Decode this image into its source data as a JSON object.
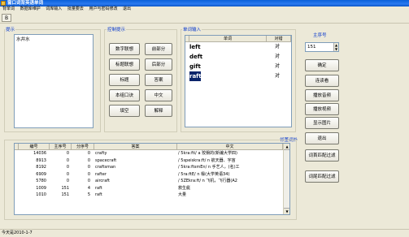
{
  "window": {
    "title": "窗口词背英语单词"
  },
  "menu": [
    "背单词",
    "数据库维护",
    "词库输入",
    "批量要去",
    "用户与密码修改",
    "退出"
  ],
  "toolbar": {
    "button_label": "B"
  },
  "hint": {
    "label": "提示",
    "list_item": "水井水"
  },
  "controls": {
    "label": "控制提示",
    "buttons": [
      "数字联想",
      "前部分",
      "标题联想",
      "后部分",
      "标题",
      "答案",
      "本组口诀",
      "中文",
      "填空",
      "解释"
    ]
  },
  "word_input": {
    "label": "单词输入",
    "headers": [
      "单词",
      "对错"
    ],
    "rows": [
      {
        "word": "left",
        "mark": "对"
      },
      {
        "word": "deft",
        "mark": "对"
      },
      {
        "word": "gift",
        "mark": "对"
      },
      {
        "word": "raft",
        "mark": "对"
      }
    ]
  },
  "order": {
    "label": "主序号",
    "value": "151"
  },
  "right_buttons": [
    "确定",
    "连读看",
    "播放音频",
    "播放视频",
    "显示图片",
    "退出",
    "词首匹配过滤",
    "词尾匹配过滤"
  ],
  "nearby_label": "邻董词外",
  "table": {
    "headers": [
      "编号",
      "主序号",
      "分序号",
      "答案",
      "中文"
    ],
    "rows": [
      {
        "id": "14036",
        "main": "0",
        "sub": "0",
        "answer": "crafty",
        "cn": "/ 5kra:fti/ a 狡猾的(新编大学四)"
      },
      {
        "id": "8913",
        "main": "0",
        "sub": "0",
        "answer": "spacecraft",
        "cn": "/ 5speiskra:ft/ n 航天器、宇宙"
      },
      {
        "id": "8192",
        "main": "0",
        "sub": "0",
        "answer": "craftsman",
        "cn": "/ 5kra:ftsmEn/ n 手艺人，(名)工"
      },
      {
        "id": "6909",
        "main": "0",
        "sub": "0",
        "answer": "rafter",
        "cn": "/ 5ra:ftE/ n 椽(大学英语34)"
      },
      {
        "id": "5780",
        "main": "0",
        "sub": "0",
        "answer": "aircraft",
        "cn": "/ 5ZEkra:ft/ n 飞机，飞行器(A2"
      },
      {
        "id": "1009",
        "main": "151",
        "sub": "4",
        "answer": "raft",
        "cn": "救生艇"
      },
      {
        "id": "1010",
        "main": "151",
        "sub": "5",
        "answer": "raft",
        "cn": "大量"
      }
    ]
  },
  "status": "今天是2010-1-7"
}
